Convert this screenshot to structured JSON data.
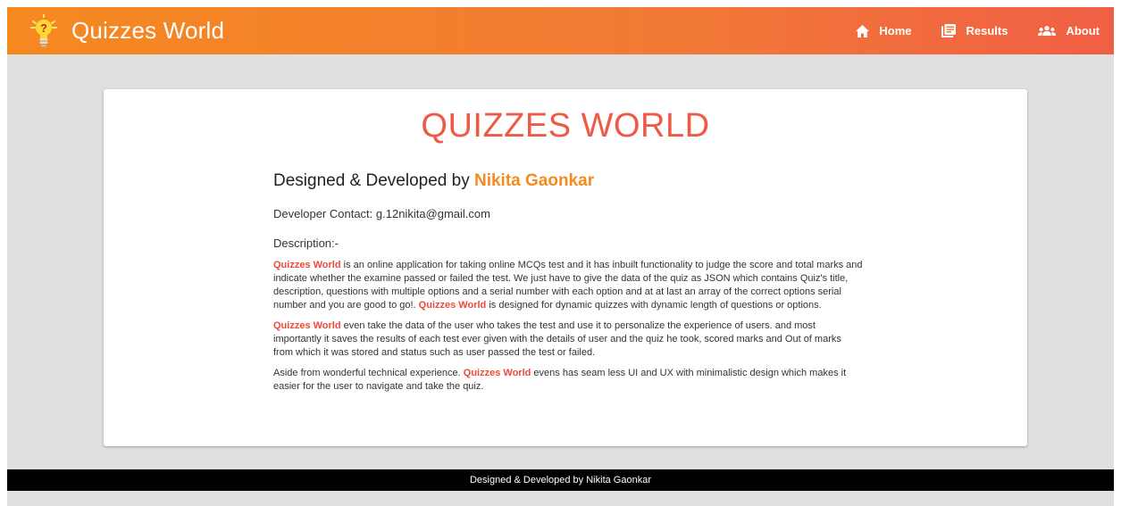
{
  "navbar": {
    "brand_title": "Quizzes World",
    "brand_icon": "lightbulb-question-icon",
    "links": [
      {
        "label": "Home",
        "icon": "home-icon"
      },
      {
        "label": "Results",
        "icon": "results-icon"
      },
      {
        "label": "About",
        "icon": "group-icon"
      }
    ],
    "gradient_colors": [
      "#f5891f",
      "#f05f45"
    ]
  },
  "card": {
    "title": "QUIZZES WORLD",
    "designed_prefix": "Designed & Developed by ",
    "developer_name": "Nikita Gaonkar",
    "contact": "Developer Contact: g.12nikita@gmail.com",
    "description_heading": "Description:-",
    "brand_highlight": "Quizzes World",
    "paragraphs": {
      "p1_a": " is an online application for taking online MCQs test and it has inbuilt functionality to judge the score and total marks and indicate whether the examine passed or failed the test. We just have to give the data of the quiz as JSON which contains Quiz's title, description, questions with multiple options and a serial number with each option and at at last an array of the correct options serial number and you are good to go!. ",
      "p1_b": " is designed for dynamic quizzes with dynamic length of questions or options.",
      "p2": " even take the data of the user who takes the test and use it to personalize the experience of users. and most importantly it saves the results of each test ever given with the details of user and the quiz he took, scored marks and Out of marks from which it was stored and status such as user passed the test or failed.",
      "p3_a": "Aside from wonderful technical experience. ",
      "p3_b": " evens has seam less UI and UX with minimalistic design which makes it easier for the user to navigate and take the quiz."
    }
  },
  "footer": {
    "text": "Designed & Developed by Nikita Gaonkar"
  },
  "colors": {
    "title_red": "#ee5a45",
    "name_orange": "#f58b1f",
    "highlight_red": "#ee4a3a",
    "page_bg": "#e0e0e0"
  }
}
